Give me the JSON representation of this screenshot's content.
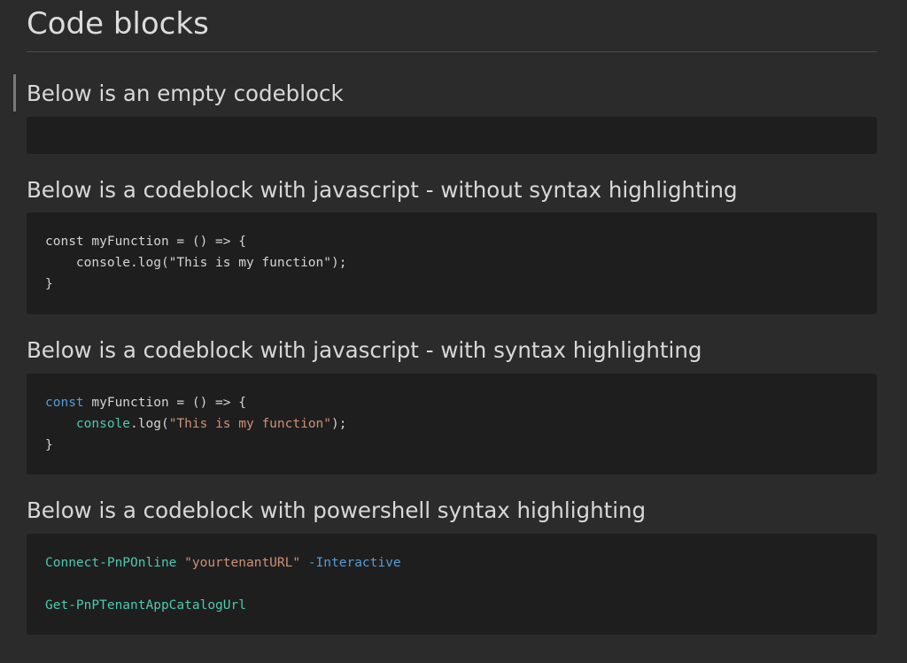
{
  "page": {
    "title": "Code blocks"
  },
  "sections": [
    {
      "heading": "Below is an empty codeblock"
    },
    {
      "heading": "Below is a codeblock with javascript - without syntax highlighting",
      "lines": [
        "const myFunction = () => {",
        "    console.log(\"This is my function\");",
        "}"
      ]
    },
    {
      "heading": "Below is a codeblock with javascript - with syntax highlighting",
      "tokens": {
        "line1_kw": "const",
        "line1_rest": " myFunction = () => {",
        "line2_indent": "    ",
        "line2_obj": "console",
        "line2_call": ".log(",
        "line2_str": "\"This is my function\"",
        "line2_end": ");",
        "line3": "}"
      }
    },
    {
      "heading": "Below is a codeblock with powershell syntax highlighting",
      "tokens": {
        "cmd1": "Connect-PnPOnline",
        "arg1": "\"yourtenantURL\"",
        "param1": "-Interactive",
        "cmd2": "Get-PnPTenantAppCatalogUrl"
      }
    }
  ],
  "colors": {
    "background": "#2b2b2b",
    "code_background": "#1e1e1e",
    "keyword": "#569cd6",
    "function": "#4ec9b0",
    "string": "#ce9178"
  }
}
